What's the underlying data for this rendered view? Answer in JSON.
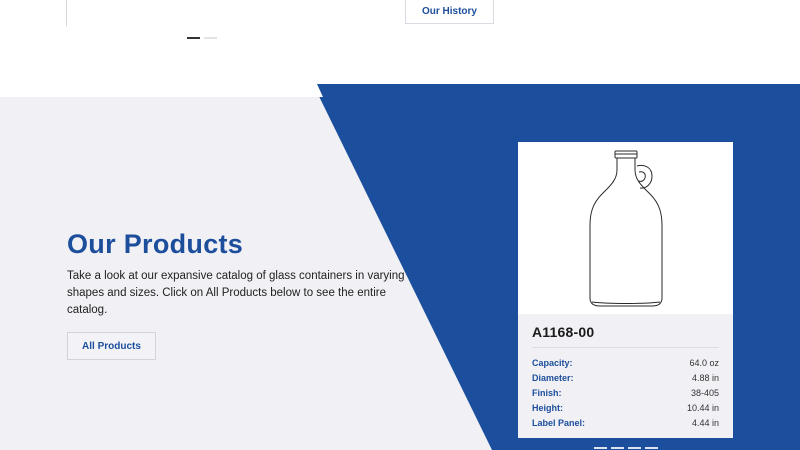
{
  "top": {
    "history_button": "Our History"
  },
  "products": {
    "heading": "Our Products",
    "description": "Take a look at our expansive catalog of glass containers in varying shapes and sizes. Click on All Products below to see the entire catalog.",
    "all_button": "All Products"
  },
  "card": {
    "sku": "A1168-00",
    "image_icon": "jug-with-handle-icon",
    "specs": [
      {
        "label": "Capacity:",
        "value": "64.0 oz"
      },
      {
        "label": "Diameter:",
        "value": "4.88 in"
      },
      {
        "label": "Finish:",
        "value": "38-405"
      },
      {
        "label": "Height:",
        "value": "10.44 in"
      },
      {
        "label": "Label Panel:",
        "value": "4.44 in"
      }
    ]
  },
  "colors": {
    "brand_blue": "#1b4e9d",
    "section_bg": "#f0f0f5"
  }
}
